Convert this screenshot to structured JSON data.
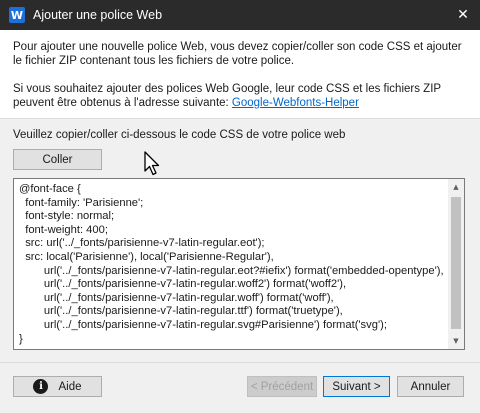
{
  "window": {
    "title": "Ajouter une police Web",
    "app_icon_letter": "W"
  },
  "intro": {
    "paragraph1": "Pour ajouter une nouvelle police Web, vous devez copier/coller son code CSS et ajouter le fichier ZIP contenant tous les fichiers de votre police.",
    "paragraph2": "Si vous souhaitez ajouter des polices Web Google, leur code CSS et les fichiers ZIP peuvent être obtenus à l'adresse suivante: ",
    "link": "Google-Webfonts-Helper"
  },
  "instruction": "Veuillez copier/coller ci-dessous le code CSS de votre police web",
  "paste_button": "Coller",
  "css_code": "@font-face {\n  font-family: 'Parisienne';\n  font-style: normal;\n  font-weight: 400;\n  src: url('../_fonts/parisienne-v7-latin-regular.eot');\n  src: local('Parisienne'), local('Parisienne-Regular'),\n        url('../_fonts/parisienne-v7-latin-regular.eot?#iefix') format('embedded-opentype'),\n        url('../_fonts/parisienne-v7-latin-regular.woff2') format('woff2'),\n        url('../_fonts/parisienne-v7-latin-regular.woff') format('woff'),\n        url('../_fonts/parisienne-v7-latin-regular.ttf') format('truetype'),\n        url('../_fonts/parisienne-v7-latin-regular.svg#Parisienne') format('svg');\n}",
  "footer": {
    "help": "Aide",
    "help_icon_glyph": "i",
    "previous": "< Précédent",
    "next": "Suivant >",
    "cancel": "Annuler"
  },
  "icons": {
    "close": "close-icon",
    "help": "info-icon",
    "cursor": "mouse-pointer-icon"
  },
  "colors": {
    "titlebar": "#2b2b2b",
    "link": "#0066cc",
    "default_button_border": "#0078d7",
    "app_icon": "#1e6fd9"
  }
}
